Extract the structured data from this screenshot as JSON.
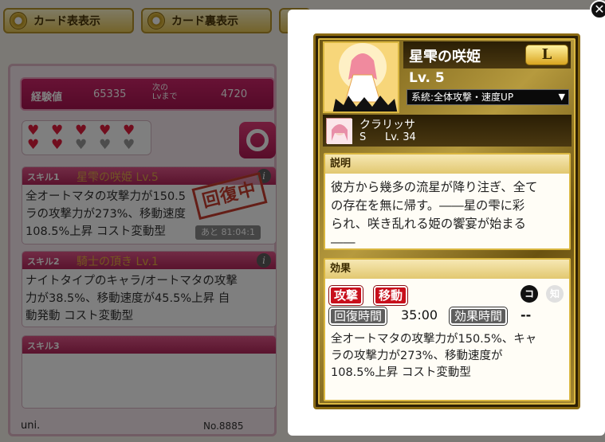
{
  "toolbar": {
    "front_label": "カード表表示",
    "back_label": "カード裏表示"
  },
  "card": {
    "exp_label": "経験値",
    "exp_value": "65335",
    "next_label_1": "次の",
    "next_label_2": "Lvまで",
    "next_value": "4720",
    "hearts_filled": 7,
    "hearts_total": 10,
    "recovering_stamp": "回復中",
    "skills": [
      {
        "tag": "スキル1",
        "name": "星雫の咲姫 Lv.5",
        "lines": [
          "全オートマタの攻撃力が150.5",
          "ラの攻撃力が273%、移動速度",
          "108.5%上昇 コスト変動型"
        ],
        "time": "あと 81:04:1"
      },
      {
        "tag": "スキル2",
        "name": "騎士の頂き Lv.1",
        "lines": [
          "ナイトタイプのキャラ/オートマタの攻撃",
          "力が38.5%、移動速度が45.5%上昇 自",
          "動発動 コスト変動型"
        ]
      },
      {
        "tag": "スキル3",
        "name": "",
        "lines": []
      }
    ],
    "user": "uni.",
    "number": "No.8885"
  },
  "detail": {
    "name": "星雫の咲姫",
    "rarity": "L",
    "level": "Lv. 5",
    "system_select": "系統:全体攻撃・速度UP",
    "sub_char_name": "クラリッサ",
    "sub_char_rank": "S",
    "sub_char_level": "Lv. 34",
    "description_title": "説明",
    "description_lines": [
      "彼方から幾多の流星が降り注ぎ、全て",
      "の存在を無に帰す。――星の雫に彩",
      "られ、咲き乱れる姫の饗宴が始まる",
      "――"
    ],
    "effect_title": "効果",
    "tags": [
      "攻撃",
      "移動"
    ],
    "type_icons": [
      "コ",
      "知"
    ],
    "recovery_label": "回復時間",
    "recovery_value": "35:00",
    "duration_label": "効果時間",
    "duration_value": "--",
    "effect_lines": [
      "全オートマタの攻撃力が150.5%、キャ",
      "ラの攻撃力が273%、移動速度が",
      "108.5%上昇 コスト変動型"
    ]
  }
}
